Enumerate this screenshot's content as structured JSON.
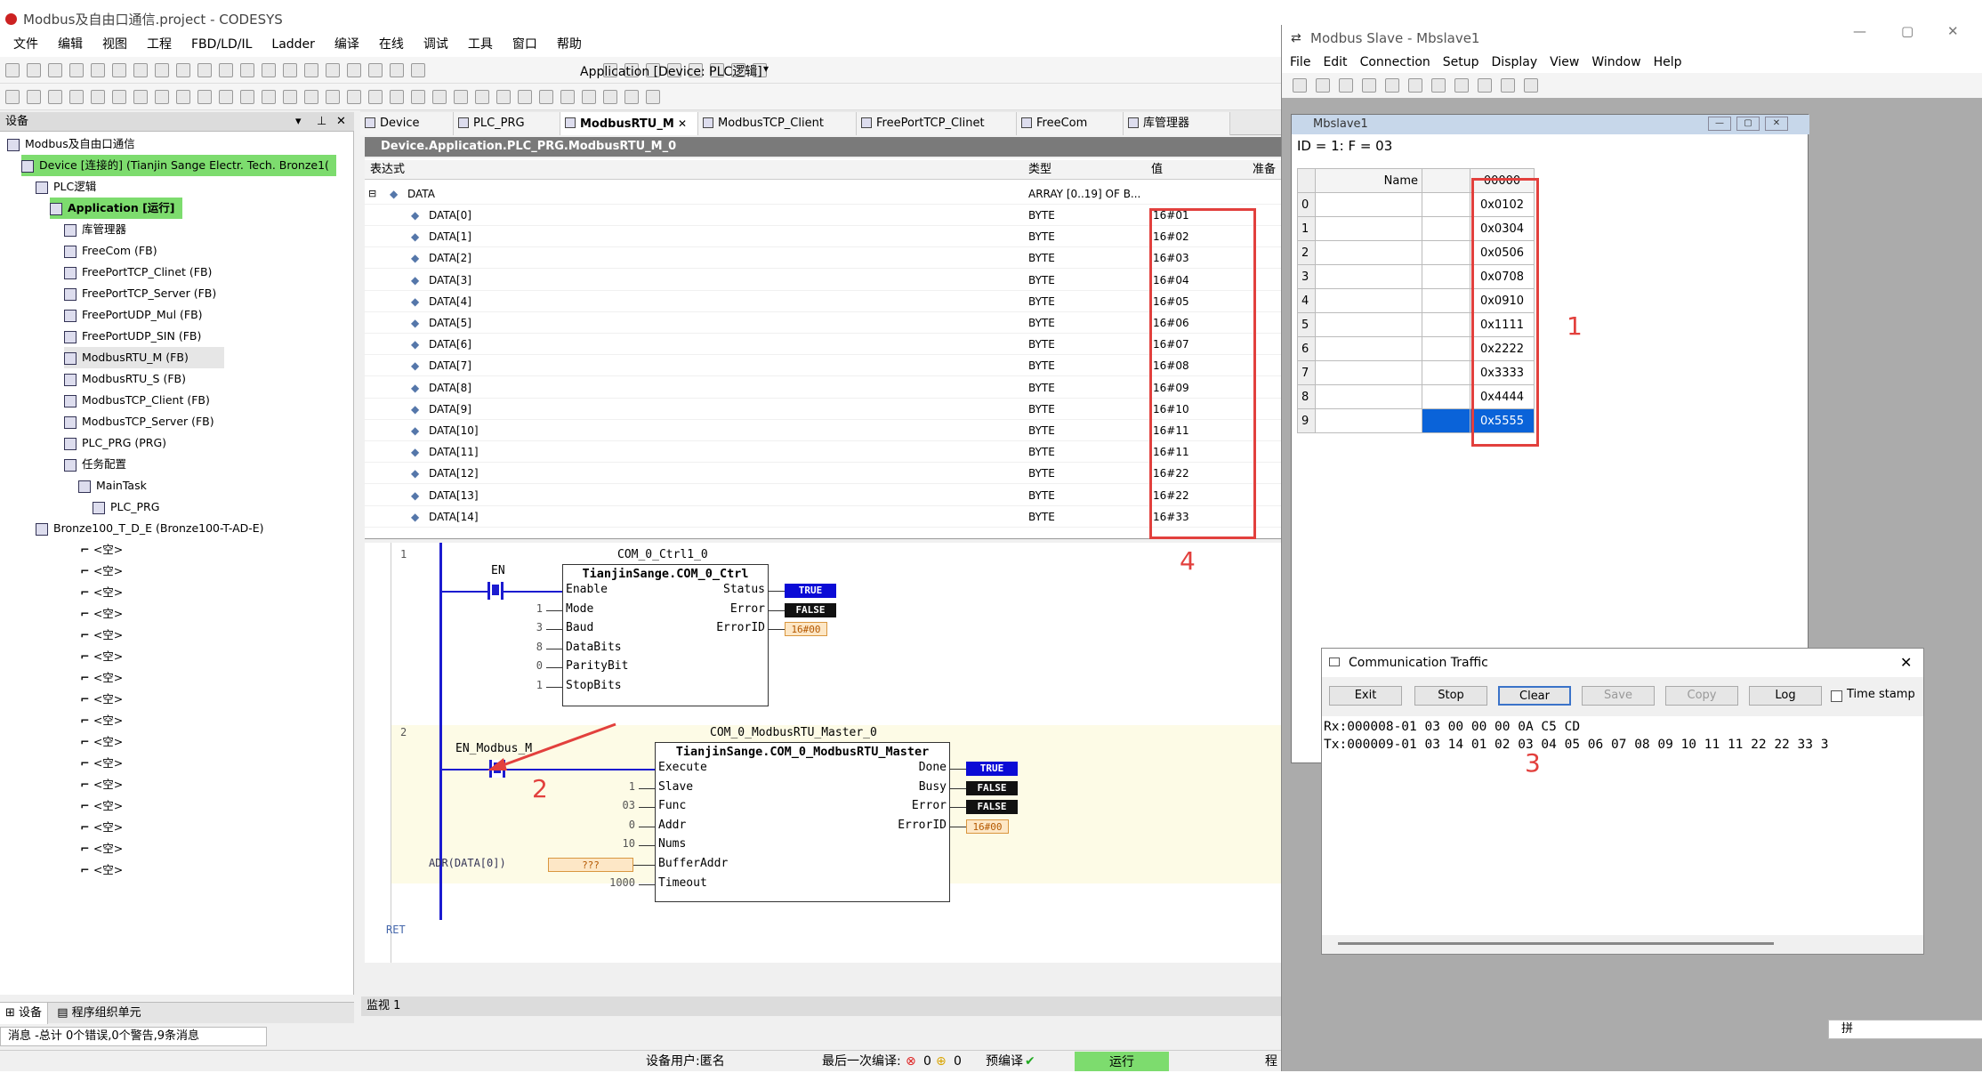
{
  "codesys": {
    "title": "Modbus及自由口通信.project - CODESYS",
    "menu": [
      "文件",
      "编辑",
      "视图",
      "工程",
      "FBD/LD/IL",
      "Ladder",
      "编译",
      "在线",
      "调试",
      "工具",
      "窗口",
      "帮助"
    ],
    "toolbar_app": "Application [Device: PLC逻辑]",
    "panel_title": "设备",
    "tree": [
      {
        "label": "Modbus及自由口通信",
        "indent": 0,
        "hl": false
      },
      {
        "label": "Device [连接的] (Tianjin Sange Electr. Tech. Bronze1(",
        "indent": 1,
        "hl": true
      },
      {
        "label": "PLC逻辑",
        "indent": 2,
        "hl": false
      },
      {
        "label": "Application [运行]",
        "indent": 3,
        "hl": true
      },
      {
        "label": "库管理器",
        "indent": 4,
        "hl": false
      },
      {
        "label": "FreeCom (FB)",
        "indent": 4,
        "hl": false
      },
      {
        "label": "FreePortTCP_Clinet (FB)",
        "indent": 4,
        "hl": false
      },
      {
        "label": "FreePortTCP_Server (FB)",
        "indent": 4,
        "hl": false
      },
      {
        "label": "FreePortUDP_Mul (FB)",
        "indent": 4,
        "hl": false
      },
      {
        "label": "FreePortUDP_SIN (FB)",
        "indent": 4,
        "hl": false
      },
      {
        "label": "ModbusRTU_M (FB)",
        "indent": 4,
        "hl": false,
        "sel": true
      },
      {
        "label": "ModbusRTU_S (FB)",
        "indent": 4,
        "hl": false
      },
      {
        "label": "ModbusTCP_Client (FB)",
        "indent": 4,
        "hl": false
      },
      {
        "label": "ModbusTCP_Server (FB)",
        "indent": 4,
        "hl": false
      },
      {
        "label": "PLC_PRG (PRG)",
        "indent": 4,
        "hl": false
      },
      {
        "label": "任务配置",
        "indent": 4,
        "hl": false
      },
      {
        "label": "MainTask",
        "indent": 5,
        "hl": false
      },
      {
        "label": "PLC_PRG",
        "indent": 6,
        "hl": false
      },
      {
        "label": "Bronze100_T_D_E (Bronze100-T-AD-E)",
        "indent": 2,
        "hl": false
      }
    ],
    "empty_slot": "<空>",
    "empty_count": 16,
    "bottom_tabs": [
      "设备",
      "程序组织单元"
    ],
    "messages": "消息 -总计 0个错误,0个警告,9条消息",
    "editor_tabs": [
      "Device",
      "PLC_PRG",
      "ModbusRTU_M",
      "ModbusTCP_Client",
      "FreePortTCP_Clinet",
      "FreeCom",
      "库管理器"
    ],
    "path": "Device.Application.PLC_PRG.ModbusRTU_M_0",
    "watch_headers": {
      "expr": "表达式",
      "type": "类型",
      "value": "值",
      "prep": "准备"
    },
    "watch_root": {
      "name": "DATA",
      "type": "ARRAY [0..19] OF B..."
    },
    "watch_rows": [
      {
        "name": "DATA[0]",
        "type": "BYTE",
        "value": "16#01"
      },
      {
        "name": "DATA[1]",
        "type": "BYTE",
        "value": "16#02"
      },
      {
        "name": "DATA[2]",
        "type": "BYTE",
        "value": "16#03"
      },
      {
        "name": "DATA[3]",
        "type": "BYTE",
        "value": "16#04"
      },
      {
        "name": "DATA[4]",
        "type": "BYTE",
        "value": "16#05"
      },
      {
        "name": "DATA[5]",
        "type": "BYTE",
        "value": "16#06"
      },
      {
        "name": "DATA[6]",
        "type": "BYTE",
        "value": "16#07"
      },
      {
        "name": "DATA[7]",
        "type": "BYTE",
        "value": "16#08"
      },
      {
        "name": "DATA[8]",
        "type": "BYTE",
        "value": "16#09"
      },
      {
        "name": "DATA[9]",
        "type": "BYTE",
        "value": "16#10"
      },
      {
        "name": "DATA[10]",
        "type": "BYTE",
        "value": "16#11"
      },
      {
        "name": "DATA[11]",
        "type": "BYTE",
        "value": "16#11"
      },
      {
        "name": "DATA[12]",
        "type": "BYTE",
        "value": "16#22"
      },
      {
        "name": "DATA[13]",
        "type": "BYTE",
        "value": "16#22"
      },
      {
        "name": "DATA[14]",
        "type": "BYTE",
        "value": "16#33"
      }
    ],
    "rung1": {
      "num": "1",
      "instance": "COM_0_Ctrl1_0",
      "type": "TianjinSange.COM_0_Ctrl",
      "contact": "EN",
      "inputs": [
        {
          "pin": "Enable",
          "val": ""
        },
        {
          "pin": "Mode",
          "val": "1"
        },
        {
          "pin": "Baud",
          "val": "3"
        },
        {
          "pin": "DataBits",
          "val": "8"
        },
        {
          "pin": "ParityBit",
          "val": "0"
        },
        {
          "pin": "StopBits",
          "val": "1"
        }
      ],
      "outputs": [
        {
          "pin": "Status",
          "val": "TRUE"
        },
        {
          "pin": "Error",
          "val": "FALSE"
        },
        {
          "pin": "ErrorID",
          "val": "16#00"
        }
      ]
    },
    "rung2": {
      "num": "2",
      "instance": "COM_0_ModbusRTU_Master_0",
      "type": "TianjinSange.COM_0_ModbusRTU_Master",
      "contact": "EN_Modbus_M",
      "inputs": [
        {
          "pin": "Execute",
          "val": ""
        },
        {
          "pin": "Slave",
          "val": "1"
        },
        {
          "pin": "Func",
          "val": "03"
        },
        {
          "pin": "Addr",
          "val": "0"
        },
        {
          "pin": "Nums",
          "val": "10"
        },
        {
          "pin": "BufferAddr",
          "val": "ADR(DATA[0])"
        },
        {
          "pin": "Timeout",
          "val": "1000"
        }
      ],
      "buffer_val": "???",
      "outputs": [
        {
          "pin": "Done",
          "val": "TRUE"
        },
        {
          "pin": "Busy",
          "val": "FALSE"
        },
        {
          "pin": "Error",
          "val": "FALSE"
        },
        {
          "pin": "ErrorID",
          "val": "16#00"
        }
      ]
    },
    "ret": "RET",
    "monitor_tab": "监视 1",
    "status": {
      "user": "设备用户:匿名",
      "last_compile": "最后一次编译:",
      "errors": "0",
      "warnings": "0",
      "precompile": "预编译",
      "run": "运行",
      "extra": "程"
    }
  },
  "annotations": [
    "1",
    "2",
    "3",
    "4"
  ],
  "mbslave": {
    "title": "Modbus Slave - Mbslave1",
    "menu": [
      "File",
      "Edit",
      "Connection",
      "Setup",
      "Display",
      "View",
      "Window",
      "Help"
    ],
    "inner_title": "Mbslave1",
    "id_line": "ID = 1: F = 03",
    "grid_header": {
      "name": "Name",
      "col": "00000"
    },
    "grid_rows": [
      {
        "idx": "0",
        "val": "0x0102"
      },
      {
        "idx": "1",
        "val": "0x0304"
      },
      {
        "idx": "2",
        "val": "0x0506"
      },
      {
        "idx": "3",
        "val": "0x0708"
      },
      {
        "idx": "4",
        "val": "0x0910"
      },
      {
        "idx": "5",
        "val": "0x1111"
      },
      {
        "idx": "6",
        "val": "0x2222"
      },
      {
        "idx": "7",
        "val": "0x3333"
      },
      {
        "idx": "8",
        "val": "0x4444"
      },
      {
        "idx": "9",
        "val": "0x5555"
      }
    ],
    "traffic": {
      "title": "Communication Traffic",
      "buttons": [
        "Exit",
        "Stop",
        "Clear",
        "Save",
        "Copy",
        "Log"
      ],
      "timestamp": "Time stamp",
      "rx": "Rx:000008-01 03 00 00 00 0A C5 CD",
      "tx": "Tx:000009-01 03 14 01 02 03 04 05 06 07 08 09 10 11 11 22 22 33 3"
    },
    "statusbar": "拼"
  },
  "colors": {
    "highlight": "#7ddc6e",
    "annot": "#e2403d",
    "true_blue": "#0b0bd6",
    "sel": "#0a63d9"
  }
}
